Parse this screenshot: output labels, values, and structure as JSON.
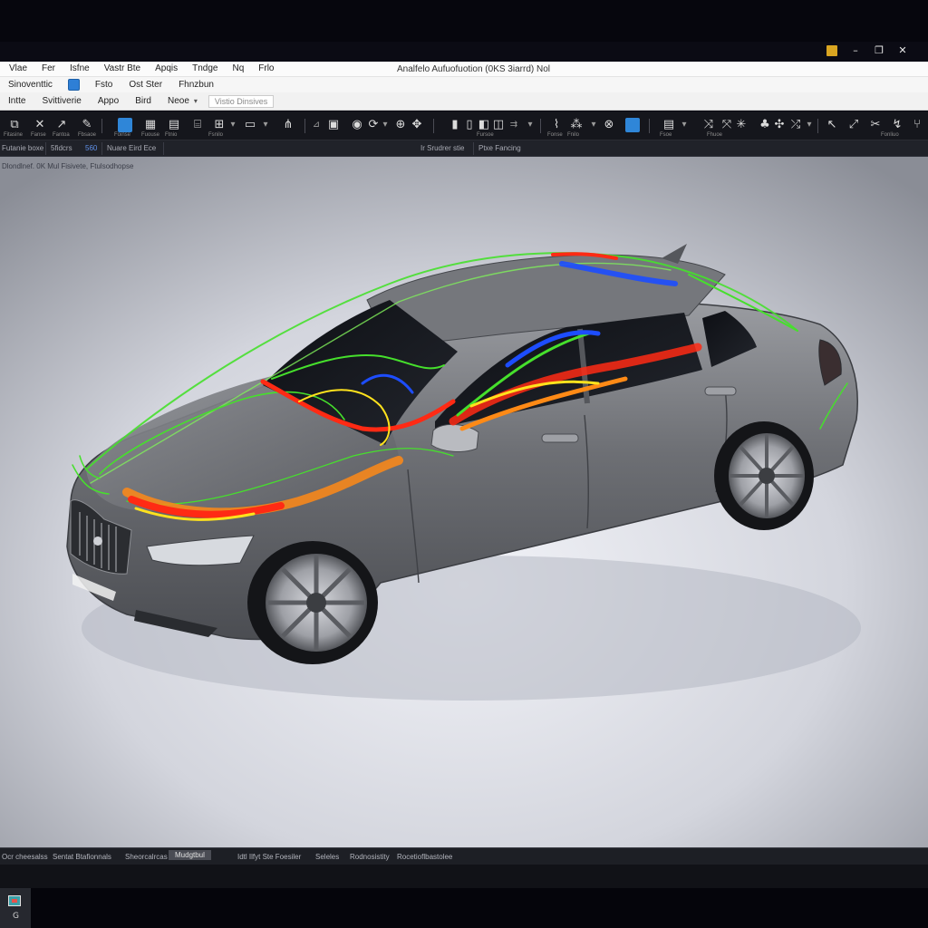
{
  "window": {
    "title": "Analfelo Aufuofuotion (0KS 3iarrd) Nol",
    "controls": {
      "app_icon": "app-icon",
      "minimize": "–",
      "restore": "❐",
      "close": "✕"
    }
  },
  "menu": {
    "items": [
      "Vlae",
      "Fer",
      "Isfne",
      "Vastr Bte",
      "Apqis",
      "Tndge",
      "Nq",
      "Frlo"
    ]
  },
  "ribbon": {
    "row1": {
      "items": [
        "Sinoventtic",
        "Fsto",
        "Ost Ster",
        "Fhnzbun"
      ]
    },
    "row2": {
      "items": [
        "Intte",
        "Svittiverie",
        "Appo",
        "Bird",
        "Neoe"
      ],
      "field": "Vistio Dinsives"
    }
  },
  "toolbar": {
    "captions": [
      "Fitasine",
      "Fanse",
      "Fantoa",
      "Fbsaoe",
      "Foinse",
      "Fuouse",
      "Ftnio",
      "Fsnilo",
      "Fursoe",
      "Fonse",
      "Fnilo",
      "Fsoe",
      "Fhuoe",
      "Fonliuo"
    ]
  },
  "subbar": {
    "items": [
      "Futanie boxe",
      "5fidcrs",
      "560",
      "Nuare Eird Ece",
      "Ir Srudrer stie",
      "Ptxe Fancing"
    ]
  },
  "viewport": {
    "label": "Dlondlnef. 0K Mul Fisivete, Ftulsodhopse"
  },
  "status": {
    "items": [
      "Ocr cheesalss",
      "Sentat Btafionnals",
      "Sheorcalrcas",
      "Mudgtbul",
      "Idtl Ilfyt Ste Foesiler",
      "Seleles",
      "Rodnosistity",
      "Rocetioflbastolee"
    ],
    "active_index": 3
  },
  "taskbar": {
    "app_icon": "cfd-app-icon",
    "sub": "G"
  },
  "colors": {
    "window_bg": "#06060d",
    "toolbar_bg": "#15161c",
    "accent_blue": "#2f86d8",
    "car_body": "#6e7075",
    "flow_red": "#ff2a14",
    "flow_orange": "#ff8a16",
    "flow_yellow": "#ffe21d",
    "flow_green": "#46e02c",
    "flow_blue": "#1d4dff"
  }
}
